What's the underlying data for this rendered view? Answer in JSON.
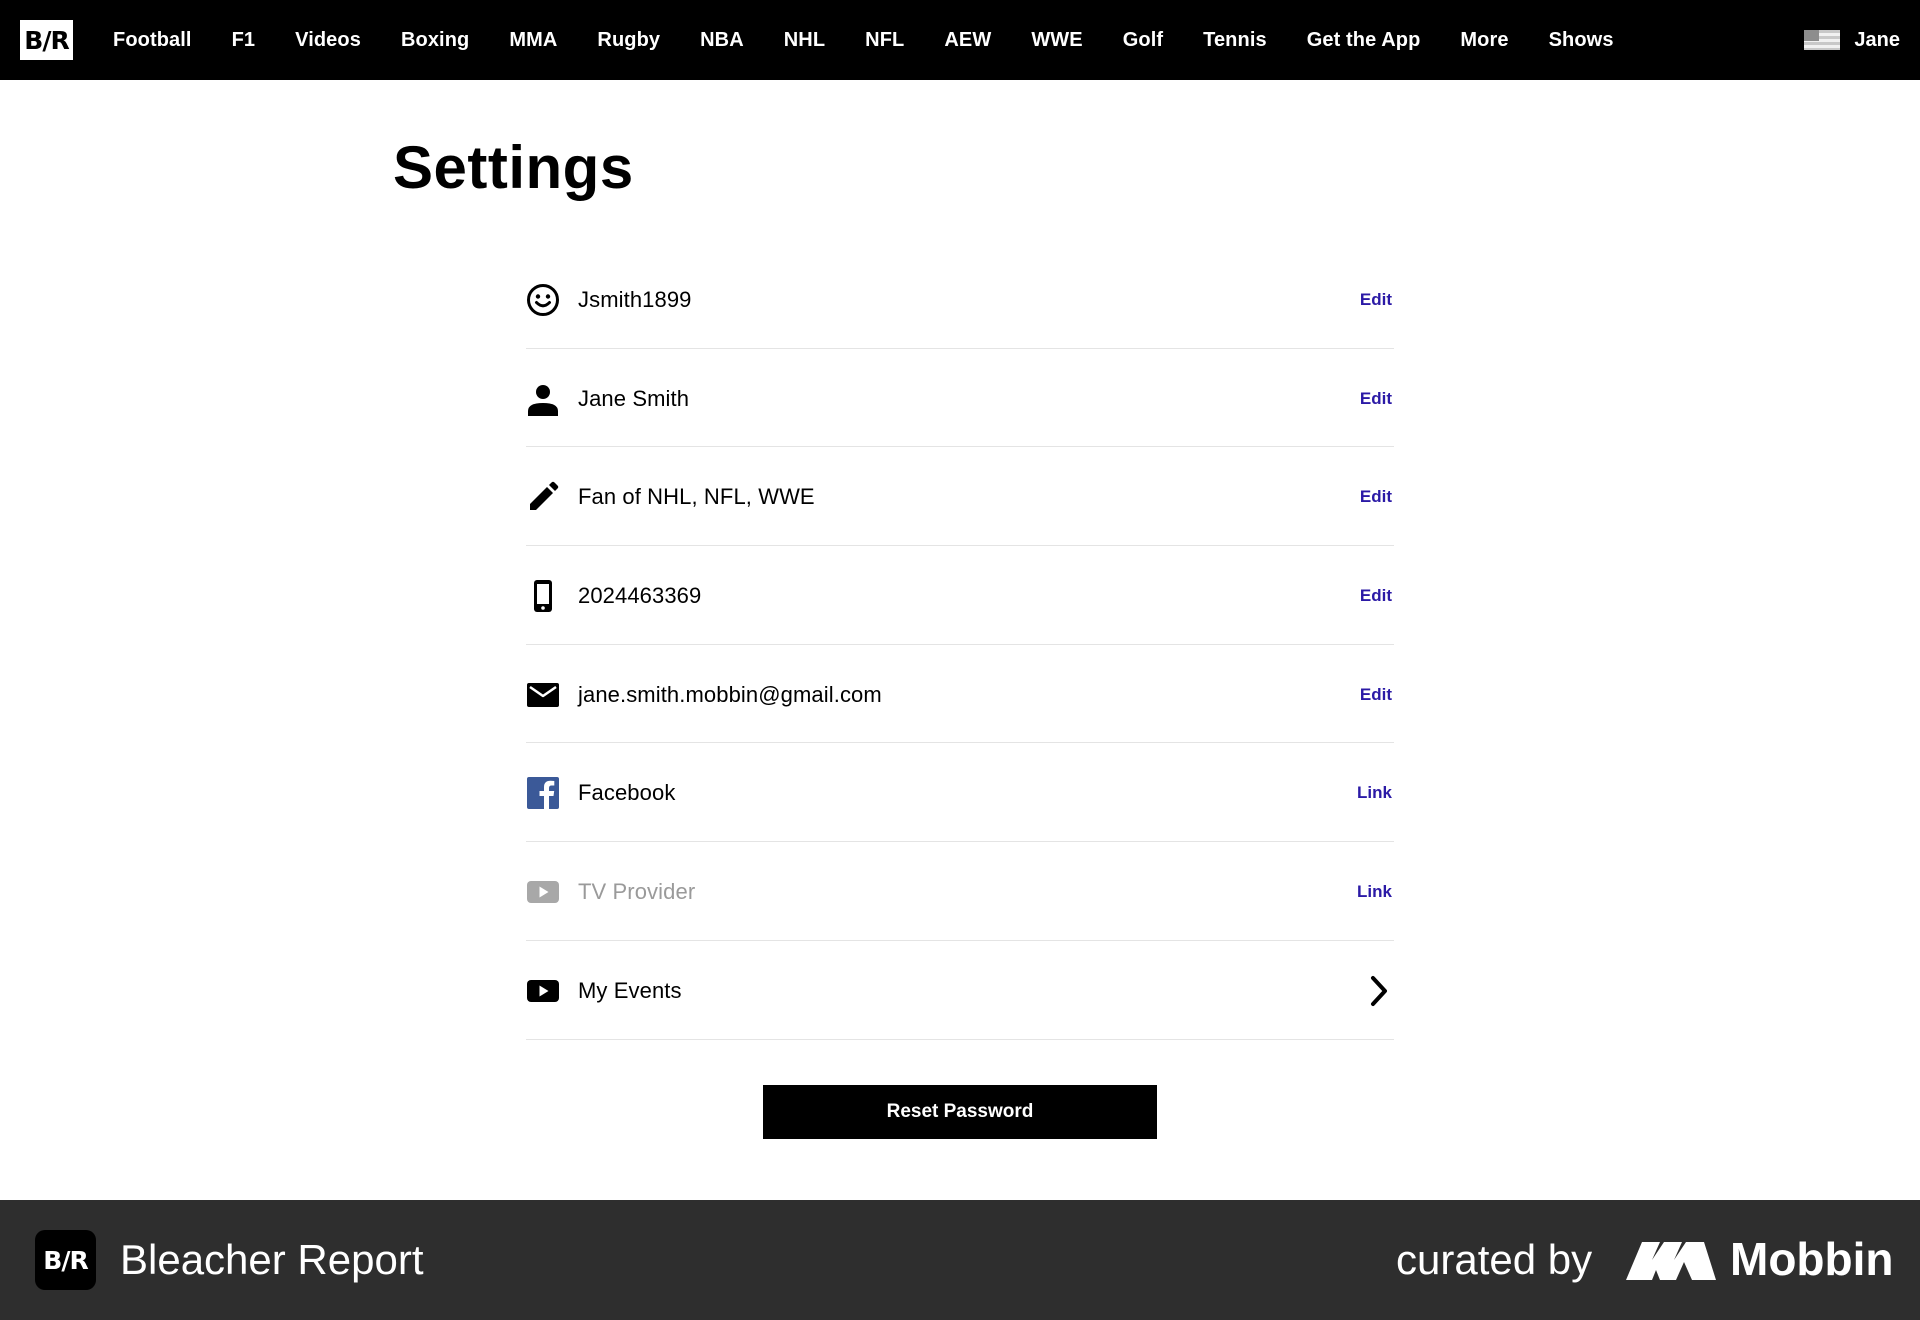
{
  "nav": {
    "logo": "B/R",
    "items": [
      "Football",
      "F1",
      "Videos",
      "Boxing",
      "MMA",
      "Rugby",
      "NBA",
      "NHL",
      "NFL",
      "AEW",
      "WWE",
      "Golf",
      "Tennis",
      "Get the App",
      "More",
      "Shows"
    ],
    "user_name": "Jane",
    "flag_icon": "us-flag-icon"
  },
  "page": {
    "title": "Settings"
  },
  "settings": [
    {
      "icon": "smiley-icon",
      "text": "Jsmith1899",
      "action": "Edit"
    },
    {
      "icon": "person-icon",
      "text": "Jane Smith",
      "action": "Edit"
    },
    {
      "icon": "pencil-icon",
      "text": "Fan of NHL, NFL, WWE",
      "action": "Edit"
    },
    {
      "icon": "phone-icon",
      "text": "2024463369",
      "action": "Edit"
    },
    {
      "icon": "mail-icon",
      "text": "jane.smith.mobbin@gmail.com",
      "action": "Edit"
    },
    {
      "icon": "facebook-icon",
      "text": "Facebook",
      "action": "Link"
    },
    {
      "icon": "play-icon",
      "text": "TV Provider",
      "action": "Link"
    },
    {
      "icon": "play-icon",
      "text": "My Events",
      "action": "chevron-right-icon"
    }
  ],
  "reset_button": "Reset Password",
  "footer": {
    "logo": "B/R",
    "brand": "Bleacher Report",
    "curated": "curated by",
    "mobbin": "Mobbin"
  },
  "colors": {
    "nav_bg": "#000000",
    "action_link": "#2b1aa6",
    "footer_bg": "#2e2e2e",
    "facebook": "#3b5998",
    "muted": "#9a9a9a"
  }
}
